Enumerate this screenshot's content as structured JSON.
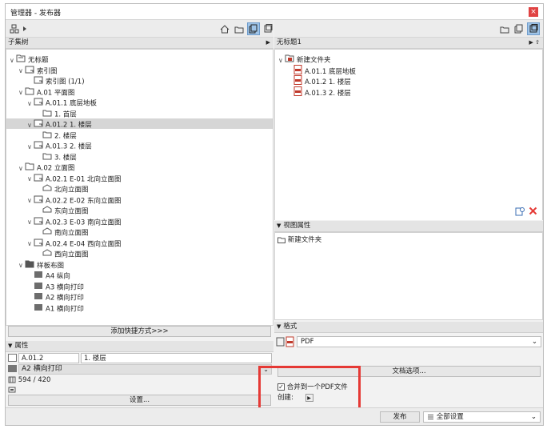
{
  "window": {
    "title": "管理器 - 发布器",
    "close_glyph": "×"
  },
  "left": {
    "panel_title": "子集树",
    "tree": [
      {
        "label": "无标题",
        "caret": "∨",
        "icon": "project-folder-icon"
      },
      {
        "label": "索引图",
        "caret": "∨",
        "icon": "layout-icon"
      },
      {
        "label": "索引图 (1/1)",
        "caret": "",
        "icon": "layout-icon"
      },
      {
        "label": "A.01 平面图",
        "caret": "∨",
        "icon": "folder-icon"
      },
      {
        "label": "A.01.1 底层地板",
        "caret": "∨",
        "icon": "layout-icon"
      },
      {
        "label": "1. 首层",
        "caret": "",
        "icon": "view-icon"
      },
      {
        "label": "A.01.2 1. 楼层",
        "caret": "∨",
        "icon": "layout-icon"
      },
      {
        "label": "2. 楼层",
        "caret": "",
        "icon": "view-icon"
      },
      {
        "label": "A.01.3 2. 楼层",
        "caret": "∨",
        "icon": "layout-icon"
      },
      {
        "label": "3. 楼层",
        "caret": "",
        "icon": "view-icon"
      },
      {
        "label": "A.02 立面图",
        "caret": "∨",
        "icon": "folder-icon"
      },
      {
        "label": "A.02.1 E-01 北向立面图",
        "caret": "∨",
        "icon": "layout-icon"
      },
      {
        "label": "北向立面图",
        "caret": "",
        "icon": "elevation-icon"
      },
      {
        "label": "A.02.2 E-02 东向立面图",
        "caret": "∨",
        "icon": "layout-icon"
      },
      {
        "label": "东向立面图",
        "caret": "",
        "icon": "elevation-icon"
      },
      {
        "label": "A.02.3 E-03 南向立面图",
        "caret": "∨",
        "icon": "layout-icon"
      },
      {
        "label": "南向立面图",
        "caret": "",
        "icon": "elevation-icon"
      },
      {
        "label": "A.02.4 E-04 西向立面图",
        "caret": "∨",
        "icon": "layout-icon"
      },
      {
        "label": "西向立面图",
        "caret": "",
        "icon": "elevation-icon"
      },
      {
        "label": "样板布图",
        "caret": "∨",
        "icon": "dark-folder-icon"
      },
      {
        "label": "A4 纵向",
        "caret": "",
        "icon": "master-layout-icon"
      },
      {
        "label": "A3 横向打印",
        "caret": "",
        "icon": "master-layout-icon"
      },
      {
        "label": "A2 横向打印",
        "caret": "",
        "icon": "master-layout-icon"
      },
      {
        "label": "A1 横向打印",
        "caret": "",
        "icon": "master-layout-icon"
      }
    ],
    "add_shortcut_label": "添加快捷方式>>>",
    "properties": {
      "header": "属性",
      "id_value": "A.01.2",
      "name_value": "1. 楼层",
      "master_value": "A2 横向打印",
      "size_value": "594 / 420",
      "settings_label": "设置..."
    }
  },
  "right": {
    "panel_title": "无标题1",
    "tree": [
      {
        "label": "新建文件夹",
        "caret": "∨",
        "icon": "publish-folder-icon"
      },
      {
        "label": "A.01.1 底层地板",
        "caret": "",
        "icon": "pdf-icon"
      },
      {
        "label": "A.01.2 1. 楼层",
        "caret": "",
        "icon": "pdf-icon"
      },
      {
        "label": "A.01.3 2. 楼层",
        "caret": "",
        "icon": "pdf-icon"
      }
    ],
    "view_properties": {
      "header": "视图属性",
      "path": "新建文件夹"
    },
    "format": {
      "header": "格式",
      "selected": "PDF",
      "doc_options_label": "文档选项...",
      "merge_label": "合并到一个PDF文件",
      "merge_checked": true,
      "create_label": "创建:"
    }
  },
  "footer": {
    "publish_label": "发布",
    "settings_select": "全部设置"
  }
}
